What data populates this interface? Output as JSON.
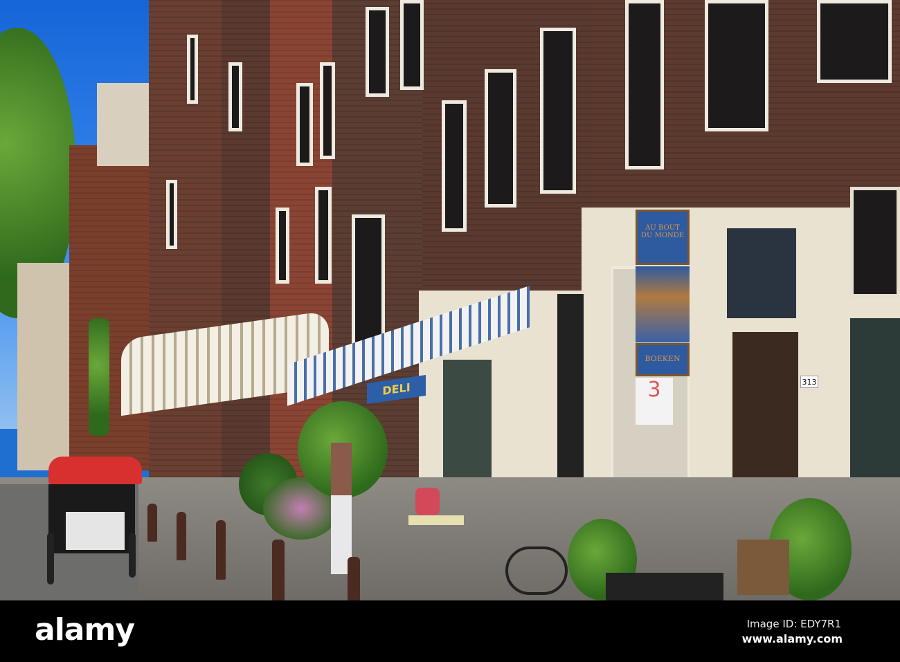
{
  "photo": {
    "shop_sign": {
      "line1": "AU BOUT",
      "line2": "DU MONDE",
      "bottom": "BOEKEN"
    },
    "awning_label": "DELI",
    "house_number": "313",
    "window_poster": "3"
  },
  "watermark": {
    "logo": "alamy",
    "image_id": "Image ID: EDY7R1",
    "url": "www.alamy.com"
  }
}
